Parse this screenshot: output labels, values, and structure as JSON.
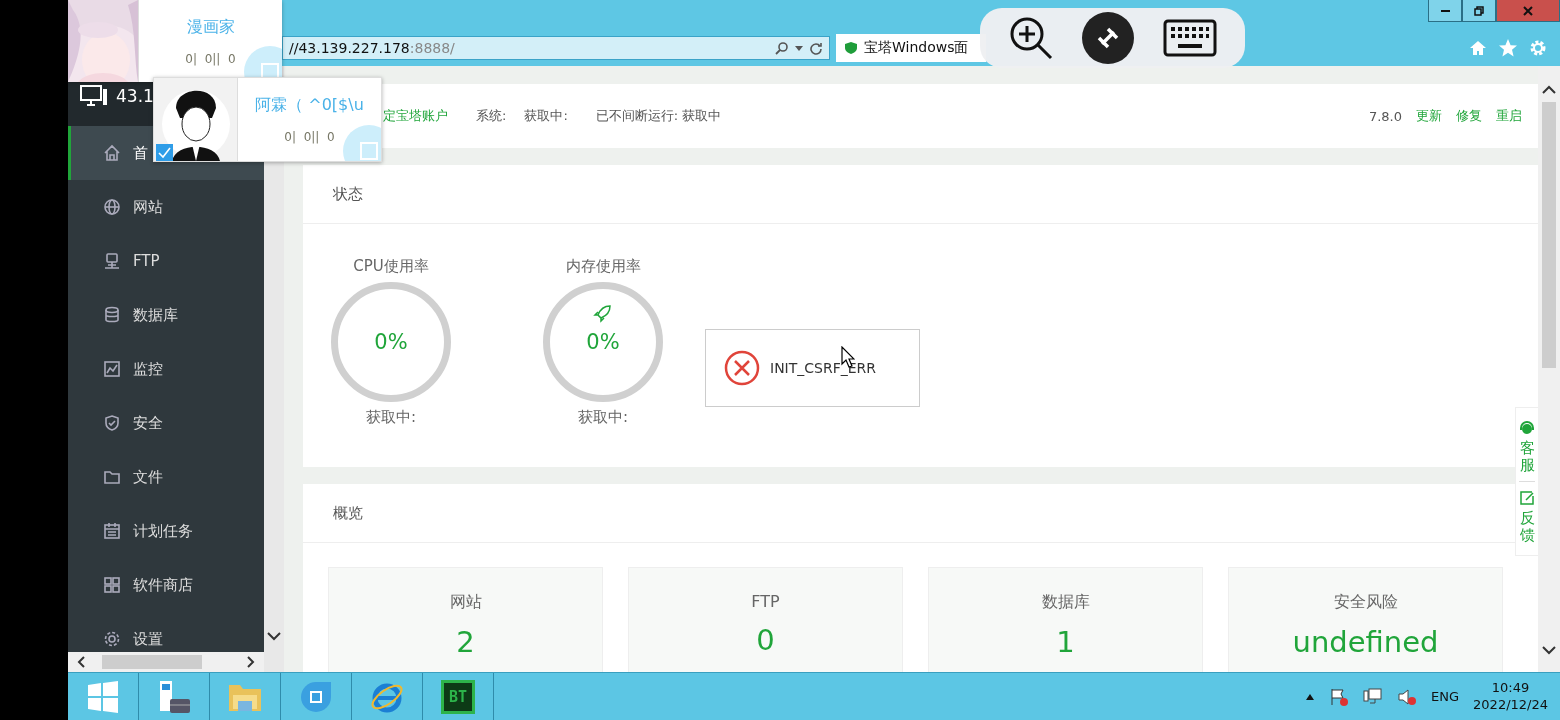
{
  "browser": {
    "address_host": "//43.139.227.178",
    "address_port": ":8888/",
    "tab_title": "宝塔Windows面"
  },
  "panel_header": {
    "bind_account": "定宝塔账户",
    "system_label": "系统:",
    "system_value": "获取中:",
    "uptime": "已不间断运行: 获取中",
    "version": "7.8.0",
    "actions": [
      "更新",
      "修复",
      "重启"
    ]
  },
  "sidebar": {
    "server": "43.1",
    "items": [
      {
        "label": "首",
        "kind": "home",
        "selected": true
      },
      {
        "label": "网站",
        "kind": "globe",
        "selected": false
      },
      {
        "label": "FTP",
        "kind": "ftp",
        "selected": false
      },
      {
        "label": "数据库",
        "kind": "database",
        "selected": false
      },
      {
        "label": "监控",
        "kind": "chart",
        "selected": false
      },
      {
        "label": "安全",
        "kind": "shield",
        "selected": false
      },
      {
        "label": "文件",
        "kind": "folder",
        "selected": false
      },
      {
        "label": "计划任务",
        "kind": "calendar",
        "selected": false
      },
      {
        "label": "软件商店",
        "kind": "grid",
        "selected": false
      },
      {
        "label": "设置",
        "kind": "gear",
        "selected": false
      }
    ]
  },
  "status": {
    "title": "状态",
    "gauges": [
      {
        "label": "CPU使用率",
        "value": "0%",
        "detail": "获取中:",
        "kind": "cpu"
      },
      {
        "label": "内存使用率",
        "value": "0%",
        "detail": "获取中:",
        "kind": "memory"
      }
    ],
    "error_toast": "INIT_CSRF_ERR"
  },
  "overview": {
    "title": "概览",
    "stats": [
      {
        "label": "网站",
        "value": "2"
      },
      {
        "label": "FTP",
        "value": "0"
      },
      {
        "label": "数据库",
        "value": "1"
      },
      {
        "label": "安全风险",
        "value": "undefined"
      }
    ]
  },
  "side_panel": [
    {
      "label": "客服",
      "kind": "support"
    },
    {
      "label": "反馈",
      "kind": "feedback"
    }
  ],
  "overlay_cards": [
    {
      "title": "漫画家",
      "stats": "0|  0||  0"
    },
    {
      "title": "阿霖（ ^0[$\\u",
      "stats": "0|  0||  0",
      "checked": true
    }
  ],
  "taskbar": {
    "apps": [
      {
        "kind": "start"
      },
      {
        "kind": "server"
      },
      {
        "kind": "folder"
      },
      {
        "kind": "bubble"
      },
      {
        "kind": "browser"
      },
      {
        "kind": "bt",
        "label": "BT"
      }
    ],
    "tray": {
      "language": "ENG",
      "time": "10:49",
      "date": "2022/12/24"
    }
  }
}
